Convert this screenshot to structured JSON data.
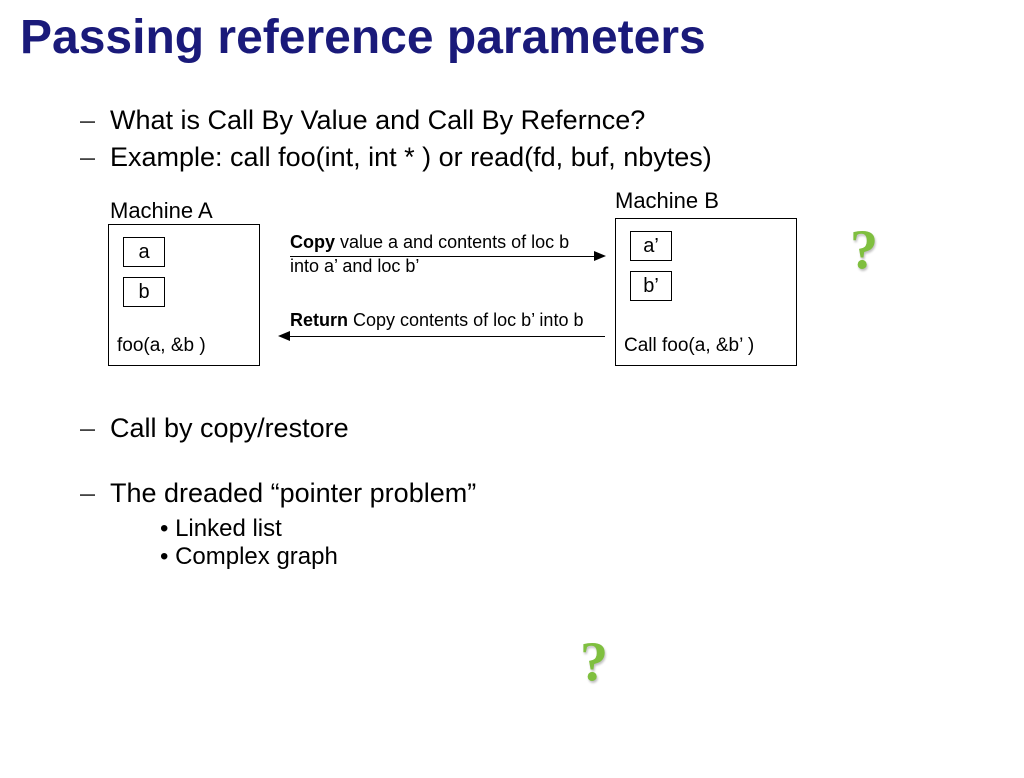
{
  "title": "Passing reference parameters",
  "bullets": {
    "b1": "What is Call By Value and Call By Refernce?",
    "b2": "Example: call foo(int, int * ) or read(fd, buf, nbytes)",
    "b3": "Call by copy/restore",
    "b4": "The dreaded “pointer problem”",
    "sub1": "Linked list",
    "sub2": "Complex graph"
  },
  "diagram": {
    "machineA": {
      "label": "Machine A",
      "var1": "a",
      "var2": "b",
      "call": "foo(a, &b )"
    },
    "machineB": {
      "label": "Machine B",
      "var1": "a’",
      "var2": "b’",
      "call": "Call foo(a, &b’ )"
    },
    "copyBold": "Copy",
    "copyRest": " value a and contents of loc b",
    "copyLine2": "into a’ and loc b’",
    "returnBold": "Return",
    "returnRest": " Copy contents of loc b’ into b"
  },
  "qmark": "?"
}
